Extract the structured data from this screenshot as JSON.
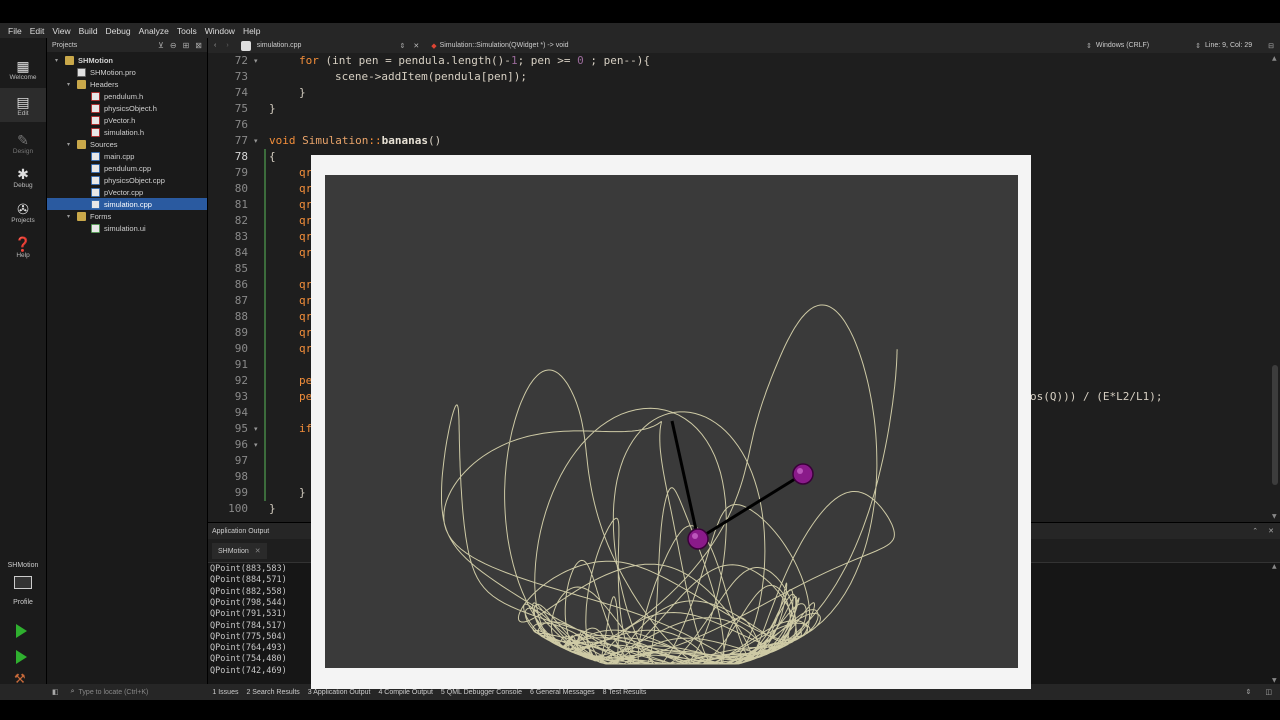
{
  "menu": [
    "File",
    "Edit",
    "View",
    "Build",
    "Debug",
    "Analyze",
    "Tools",
    "Window",
    "Help"
  ],
  "modes": [
    {
      "label": "Welcome",
      "icon": "grid-icon"
    },
    {
      "label": "Edit",
      "icon": "edit-icon"
    },
    {
      "label": "Design",
      "icon": "pen-icon"
    },
    {
      "label": "Debug",
      "icon": "bug-icon"
    },
    {
      "label": "Projects",
      "icon": "wrench-icon"
    },
    {
      "label": "Help",
      "icon": "help-icon"
    }
  ],
  "projects_title": "Projects",
  "tree": [
    {
      "label": "SHMotion",
      "icon": "folder",
      "arrow": "▾"
    },
    {
      "label": "SHMotion.pro",
      "icon": "pro",
      "arrow": ""
    },
    {
      "label": "Headers",
      "icon": "folder",
      "arrow": "▾"
    },
    {
      "label": "pendulum.h",
      "icon": "h",
      "arrow": ""
    },
    {
      "label": "physicsObject.h",
      "icon": "h",
      "arrow": ""
    },
    {
      "label": "pVector.h",
      "icon": "h",
      "arrow": ""
    },
    {
      "label": "simulation.h",
      "icon": "h",
      "arrow": ""
    },
    {
      "label": "Sources",
      "icon": "folder",
      "arrow": "▾"
    },
    {
      "label": "main.cpp",
      "icon": "cpp",
      "arrow": ""
    },
    {
      "label": "pendulum.cpp",
      "icon": "cpp",
      "arrow": ""
    },
    {
      "label": "physicsObject.cpp",
      "icon": "cpp",
      "arrow": ""
    },
    {
      "label": "pVector.cpp",
      "icon": "cpp",
      "arrow": ""
    },
    {
      "label": "simulation.cpp",
      "icon": "cpp",
      "arrow": "",
      "selected": true
    },
    {
      "label": "Forms",
      "icon": "folder",
      "arrow": "▾"
    },
    {
      "label": "simulation.ui",
      "icon": "ui",
      "arrow": ""
    }
  ],
  "editor_bar": {
    "file": "simulation.cpp",
    "symbol": "Simulation::Simulation(QWidget *) -> void",
    "line_ending": "Windows (CRLF)",
    "position": "Line: 9, Col: 29"
  },
  "code_lines": [
    {
      "n": "72",
      "fold": "▾"
    },
    {
      "n": "73",
      "fold": ""
    },
    {
      "n": "74",
      "fold": ""
    },
    {
      "n": "75",
      "fold": ""
    },
    {
      "n": "76",
      "fold": ""
    },
    {
      "n": "77",
      "fold": "▾"
    },
    {
      "n": "78",
      "fold": ""
    },
    {
      "n": "79",
      "fold": ""
    },
    {
      "n": "80",
      "fold": ""
    },
    {
      "n": "81",
      "fold": ""
    },
    {
      "n": "82",
      "fold": ""
    },
    {
      "n": "83",
      "fold": ""
    },
    {
      "n": "84",
      "fold": ""
    },
    {
      "n": "85",
      "fold": ""
    },
    {
      "n": "86",
      "fold": ""
    },
    {
      "n": "87",
      "fold": ""
    },
    {
      "n": "88",
      "fold": ""
    },
    {
      "n": "89",
      "fold": ""
    },
    {
      "n": "90",
      "fold": ""
    },
    {
      "n": "91",
      "fold": ""
    },
    {
      "n": "92",
      "fold": ""
    },
    {
      "n": "93",
      "fold": ""
    },
    {
      "n": "94",
      "fold": ""
    },
    {
      "n": "95",
      "fold": "▾"
    },
    {
      "n": "96",
      "fold": "▾"
    },
    {
      "n": "97",
      "fold": ""
    },
    {
      "n": "98",
      "fold": ""
    },
    {
      "n": "99",
      "fold": ""
    },
    {
      "n": "100",
      "fold": ""
    }
  ],
  "code_text": {
    "l72_kw": "for",
    "l72_rest1": " (int pen = pendula.length()-",
    "l72_num1": "1",
    "l72_rest2": "; pen >= ",
    "l72_num2": "0",
    "l72_rest3": " ; pen--){",
    "l73": "scene->addItem(pendula[pen]);",
    "l74": "}",
    "l75": "}",
    "l77_kw": "void",
    "l77_cls": " Simulation",
    "l77_sep": "::",
    "l77_fn": "bananas",
    "l77_tail": "()",
    "l78": "{",
    "l79": "qr",
    "l80": "qr",
    "l81": "qr",
    "l82": "qr",
    "l83": "qr",
    "l84": "qr",
    "l86": "qr",
    "l87": "qr",
    "l88": "qr",
    "l89": "qr",
    "l90": "qr",
    "l92": "pe",
    "l93": "pe",
    "l93_tail": "os(Q))) / (E*L2/L1);",
    "l95": "if",
    "l99": "}",
    "l100": "}"
  },
  "output": {
    "header": "Application Output",
    "tab": "SHMotion",
    "lines": [
      "QPoint(883,583)",
      "QPoint(884,571)",
      "QPoint(882,558)",
      "QPoint(798,544)",
      "QPoint(791,531)",
      "QPoint(784,517)",
      "QPoint(775,504)",
      "QPoint(764,493)",
      "QPoint(754,480)",
      "QPoint(742,469)"
    ]
  },
  "session": {
    "label": "SHMotion",
    "profile": "Profile"
  },
  "status": {
    "locate_placeholder": "Type to locate (Ctrl+K)",
    "panes": [
      "1  Issues",
      "2  Search Results",
      "3  Application Output",
      "4  Compile Output",
      "5  QML Debugger Console",
      "6  General Messages",
      "8  Test Results"
    ]
  },
  "colors": {
    "trace": "#e9e4b8",
    "bob": "#8a1a8a",
    "rod": "#000000",
    "canvas": "#3a3a3a",
    "selection": "#2a5aa0",
    "keyword": "#f38e3a"
  }
}
